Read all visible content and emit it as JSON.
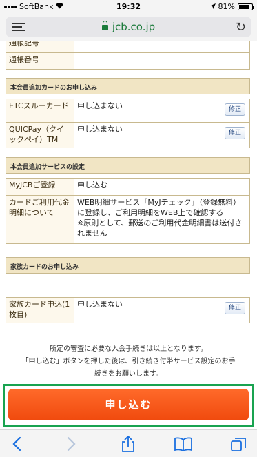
{
  "status": {
    "carrier": "SoftBank",
    "time": "19:32",
    "battery": "81%",
    "battery_level": 0.81
  },
  "browser": {
    "url": "jcb.co.jp"
  },
  "account": {
    "row_partial_label": "通帳記号",
    "row_number_label": "通帳番号",
    "row_number_value": ""
  },
  "sections": {
    "additional_card": "本会員追加カードのお申し込み",
    "additional_service": "本会員追加サービスの設定",
    "family_card": "家族カードのお申し込み"
  },
  "rows": {
    "etc": {
      "label": "ETCスルーカード",
      "value": "申し込まない",
      "edit": "修正"
    },
    "quicpay": {
      "label": "QUICPay（クイックペイ）TM",
      "value": "申し込まない",
      "edit": "修正"
    },
    "myjcb": {
      "label": "MyJCBご登録",
      "value": "申し込む"
    },
    "statement": {
      "label": "カードご利用代金明細について",
      "value": "WEB明細サービス「MyJチェック」（登録無料）に登録し、ご利用明細をWEB上で確認する",
      "note": "※原則として、郵送のご利用代金明細書は送付されません"
    },
    "family": {
      "label": "家族カード申込(1枚目)",
      "value": "申し込まない",
      "edit": "修正"
    }
  },
  "notice": {
    "line1": "所定の審査に必要な入会手続きは以上となります。",
    "line2": "「申し込む」ボタンを押した後は、引き続き付帯サービス設定のお手続きをお願いします。"
  },
  "submit_label": "申し込む"
}
